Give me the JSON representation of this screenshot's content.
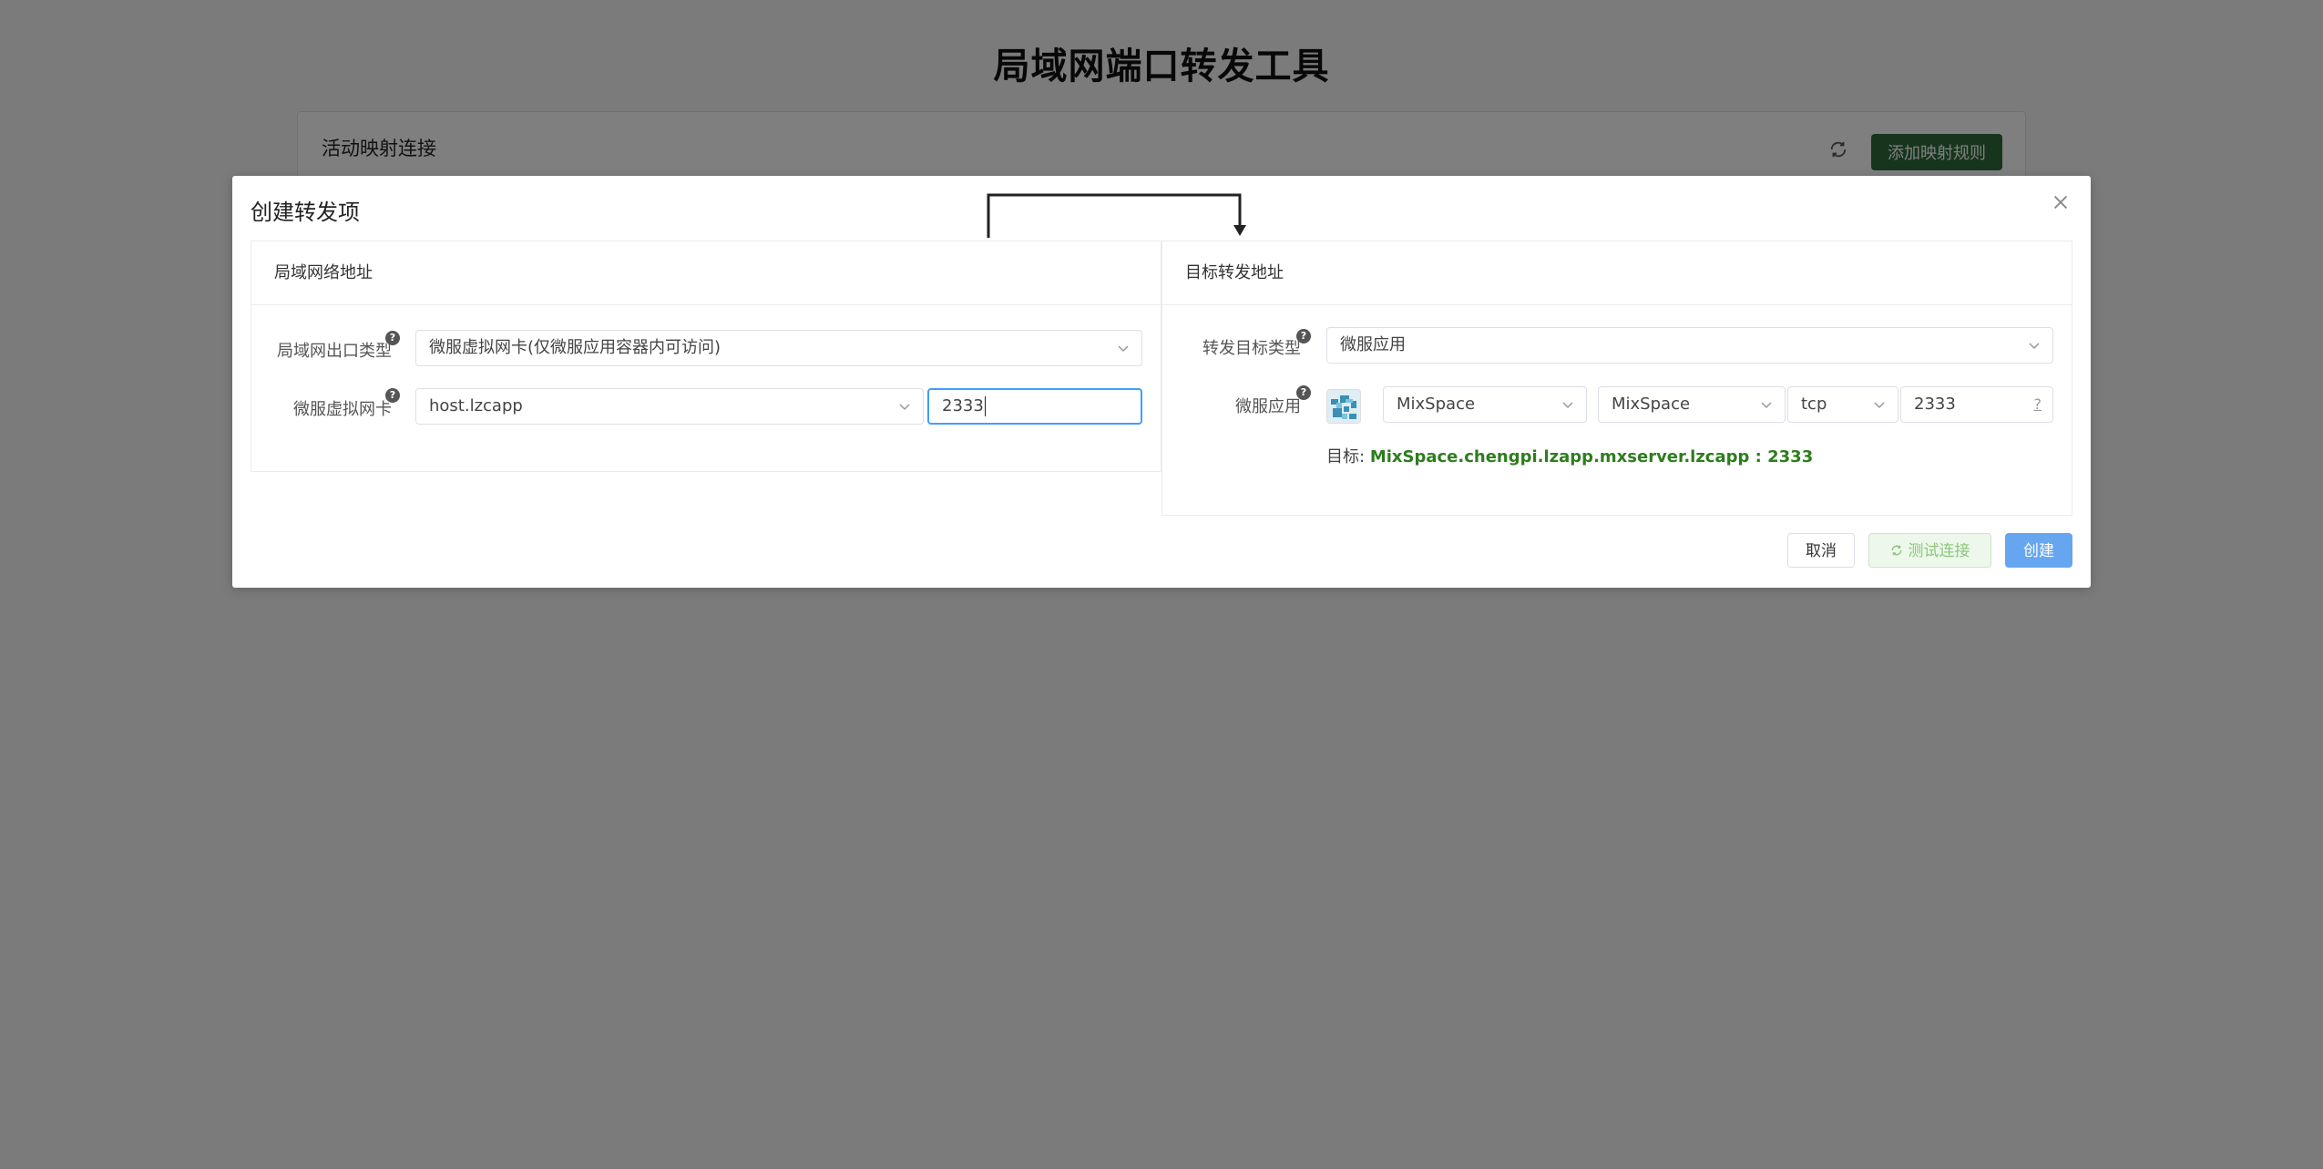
{
  "page": {
    "title": "局域网端口转发工具",
    "card_title": "活动映射连接",
    "add_rule_label": "添加映射规则"
  },
  "modal": {
    "title": "创建转发项",
    "left": {
      "header": "局域网络地址",
      "exit_type_label": "局域网出口类型",
      "exit_type_value": "微服虚拟网卡(仅微服应用容器内可访问)",
      "nic_label": "微服虚拟网卡",
      "nic_value": "host.lzcapp",
      "port_value": "2333"
    },
    "right": {
      "header": "目标转发地址",
      "target_type_label": "转发目标类型",
      "target_type_value": "微服应用",
      "app_label": "微服应用",
      "app_value": "MixSpace",
      "service_value": "MixSpace",
      "protocol_value": "tcp",
      "port_value": "2333",
      "port_hint": "?",
      "target_prefix": "目标:",
      "target_value": "MixSpace.chengpi.lzapp.mxserver.lzcapp : 2333"
    },
    "buttons": {
      "cancel": "取消",
      "test": "测试连接",
      "create": "创建"
    }
  },
  "icons": {
    "help": "?"
  },
  "colors": {
    "primary": "#409eff",
    "success": "#2e7d1e",
    "add_button": "#2f6b3a"
  }
}
